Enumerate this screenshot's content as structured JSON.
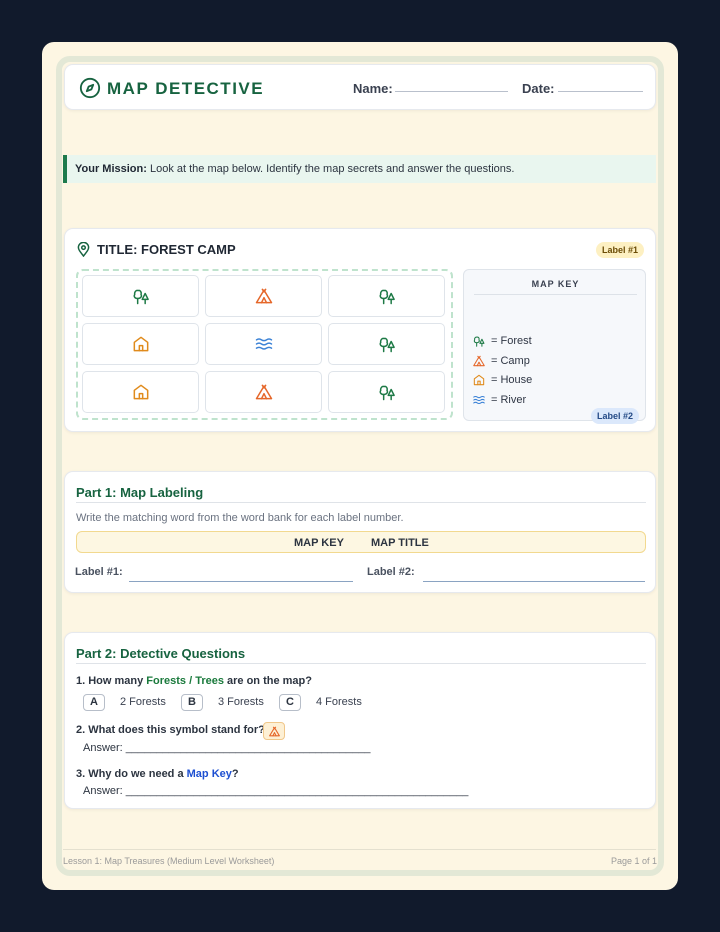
{
  "header": {
    "title": "MAP DETECTIVE",
    "name_label": "Name:",
    "date_label": "Date:",
    "logo_icon": "compass-icon"
  },
  "mission": {
    "lead": "Your Mission:",
    "text": "Look at the map below. Identify the map secrets and answer the questions."
  },
  "map": {
    "title": "TITLE: FOREST CAMP",
    "title_icon": "map-pin-icon",
    "label1_badge": "Label #1",
    "label2_badge": "Label #2",
    "grid": [
      [
        "forest",
        "camp",
        "forest"
      ],
      [
        "house",
        "river",
        "forest"
      ],
      [
        "house",
        "camp",
        "forest"
      ]
    ],
    "key": {
      "heading": "MAP KEY",
      "items": [
        {
          "icon": "forest",
          "label": "= Forest"
        },
        {
          "icon": "camp",
          "label": "= Camp"
        },
        {
          "icon": "house",
          "label": "= House"
        },
        {
          "icon": "river",
          "label": "= River"
        }
      ]
    },
    "colors": {
      "forest": "#1e7a46",
      "camp": "#e5672a",
      "house": "#e08b1c",
      "river": "#3b82d6"
    }
  },
  "part1": {
    "title": "Part 1: Map Labeling",
    "instruction": "Write the matching word from the word bank for each label number.",
    "word_bank": [
      "MAP KEY",
      "MAP TITLE"
    ],
    "field1_label": "Label #1:",
    "field2_label": "Label #2:"
  },
  "part2": {
    "title": "Part 2: Detective Questions",
    "q1": {
      "prefix": "1. How many ",
      "highlight": "Forests / Trees",
      "suffix": " are on the map?"
    },
    "options": [
      {
        "letter": "A",
        "text": "2 Forests"
      },
      {
        "letter": "B",
        "text": "3 Forests"
      },
      {
        "letter": "C",
        "text": "4 Forests"
      }
    ],
    "q2": "2. What does this symbol stand for?",
    "answer2": "Answer: ________________________________________",
    "q3": {
      "prefix": "3. Why do we need a ",
      "highlight": "Map Key",
      "suffix": "?"
    },
    "answer3": "Answer: ________________________________________________________"
  },
  "footer": {
    "left": "Lesson 1: Map Treasures (Medium Level Worksheet)",
    "right": "Page 1 of 1"
  }
}
